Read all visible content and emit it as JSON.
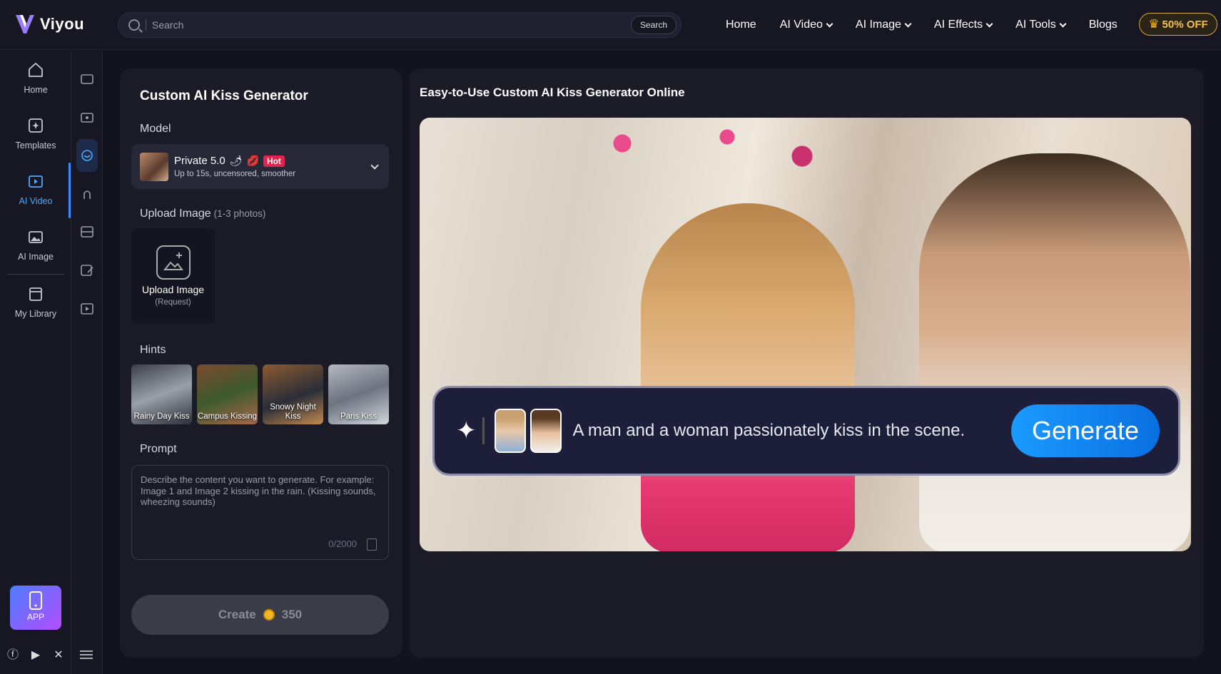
{
  "brand": {
    "name": "Viyou"
  },
  "search": {
    "placeholder": "Search",
    "button": "Search"
  },
  "nav": [
    {
      "label": "Home"
    },
    {
      "label": "AI Video"
    },
    {
      "label": "AI Image"
    },
    {
      "label": "AI Effects"
    },
    {
      "label": "AI Tools"
    },
    {
      "label": "Blogs"
    }
  ],
  "offer": {
    "label": "50% OFF"
  },
  "rail": [
    {
      "label": "Home",
      "icon": "home-icon"
    },
    {
      "label": "Templates",
      "icon": "templates-icon"
    },
    {
      "label": "AI Video",
      "icon": "ai-video-icon",
      "active": true
    },
    {
      "label": "AI Image",
      "icon": "ai-image-icon"
    },
    {
      "label": "My Library",
      "icon": "library-icon"
    }
  ],
  "app": {
    "label": "APP"
  },
  "panel": {
    "title": "Custom AI Kiss Generator",
    "model_label": "Model",
    "model": {
      "name": "Private 5.0",
      "badge": "Hot",
      "desc": "Up to 15s, uncensored, smoother"
    },
    "upload_label": "Upload Image",
    "upload_hint": "(1-3 photos)",
    "upload_button": "Upload Image",
    "upload_sub": "(Request)",
    "hints_label": "Hints",
    "hints": [
      {
        "label": "Rainy Day Kiss"
      },
      {
        "label": "Campus Kissing"
      },
      {
        "label": "Snowy Night Kiss"
      },
      {
        "label": "Paris Kiss"
      }
    ],
    "prompt_label": "Prompt",
    "prompt_placeholder": "Describe the content you want to generate. For example: Image 1 and Image 2 kissing in the rain. (Kissing sounds, wheezing sounds)",
    "counter": "0/2000",
    "create_label": "Create",
    "create_cost": "350"
  },
  "main": {
    "title": "Easy-to-Use Custom AI Kiss Generator Online",
    "hero_prompt": "A man and a woman passionately kiss in the scene.",
    "generate": "Generate"
  },
  "colors": {
    "accent": "#3d8cff",
    "hot": "#e0244d",
    "offer": "#f5c14b"
  }
}
